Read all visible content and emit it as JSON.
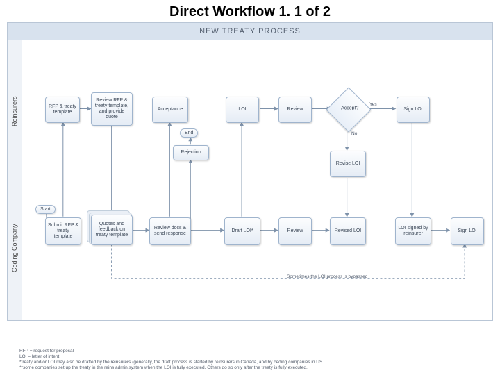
{
  "title": "Direct Workflow 1. 1 of 2",
  "header": "NEW TREATY PROCESS",
  "lanes": {
    "top": "Reinsurers",
    "bottom": "Ceding Company"
  },
  "reinsurers": {
    "rfp": "RFP & treaty template",
    "review_rfp": "Review RFP & treaty template, and provide quote",
    "acceptance": "Acceptance",
    "loi": "LOI",
    "review": "Review",
    "accept_q": "Accept?",
    "sign_loi": "Sign LOI",
    "rejection": "Rejection",
    "end": "End",
    "revise_loi": "Revise LOI"
  },
  "ceding": {
    "start": "Start",
    "submit": "Submit RFP & treaty template",
    "quotes": "Quotes and feedback on treaty template",
    "review_docs": "Review docs & send response",
    "draft_loi": "Draft LOI*",
    "review": "Review",
    "revised": "Revised LOI",
    "signed_by_reins": "LOI signed by reinsurer",
    "sign_loi": "Sign LOI"
  },
  "edge_labels": {
    "yes": "Yes",
    "no": "No"
  },
  "note_bypass": "Sometimes the LOI process is bypassed",
  "footnotes": {
    "l1": "RFP = request for proposal",
    "l2": "LOI = letter of intent",
    "l3": "*treaty and/or LOI may also be drafted by the reinsurers (generally, the draft process is started by reinsurers in Canada, and by ceding companies in US.",
    "l4": "**some companies set up the treaty in the reins admin system when the LOI is fully executed.  Others do so only after the treaty is fully executed."
  },
  "chart_data": {
    "type": "swimlane-flowchart",
    "title": "NEW TREATY PROCESS",
    "lanes": [
      "Reinsurers",
      "Ceding Company"
    ],
    "nodes": [
      {
        "id": "start",
        "lane": "Ceding Company",
        "type": "terminator",
        "label": "Start"
      },
      {
        "id": "submit",
        "lane": "Ceding Company",
        "type": "process",
        "label": "Submit RFP & treaty template"
      },
      {
        "id": "rfp",
        "lane": "Reinsurers",
        "type": "process",
        "label": "RFP & treaty template"
      },
      {
        "id": "review_rfp",
        "lane": "Reinsurers",
        "type": "process",
        "label": "Review RFP & treaty template, and provide quote"
      },
      {
        "id": "quotes",
        "lane": "Ceding Company",
        "type": "process-stack",
        "label": "Quotes and feedback on treaty template"
      },
      {
        "id": "review_docs",
        "lane": "Ceding Company",
        "type": "process",
        "label": "Review docs & send response"
      },
      {
        "id": "acceptance",
        "lane": "Reinsurers",
        "type": "process",
        "label": "Acceptance"
      },
      {
        "id": "rejection",
        "lane": "Reinsurers",
        "type": "process",
        "label": "Rejection"
      },
      {
        "id": "end",
        "lane": "Reinsurers",
        "type": "terminator",
        "label": "End"
      },
      {
        "id": "draft_loi",
        "lane": "Ceding Company",
        "type": "process",
        "label": "Draft LOI*"
      },
      {
        "id": "loi",
        "lane": "Reinsurers",
        "type": "process",
        "label": "LOI"
      },
      {
        "id": "review_r",
        "lane": "Reinsurers",
        "type": "process",
        "label": "Review"
      },
      {
        "id": "accept_q",
        "lane": "Reinsurers",
        "type": "decision",
        "label": "Accept?"
      },
      {
        "id": "sign_loi_r",
        "lane": "Reinsurers",
        "type": "process",
        "label": "Sign LOI"
      },
      {
        "id": "revise_loi",
        "lane": "Reinsurers",
        "type": "process",
        "label": "Revise LOI"
      },
      {
        "id": "review_c",
        "lane": "Ceding Company",
        "type": "process",
        "label": "Review"
      },
      {
        "id": "revised",
        "lane": "Ceding Company",
        "type": "process",
        "label": "Revised LOI"
      },
      {
        "id": "signed_by_reins",
        "lane": "Ceding Company",
        "type": "process",
        "label": "LOI signed by reinsurer"
      },
      {
        "id": "sign_loi_c",
        "lane": "Ceding Company",
        "type": "process",
        "label": "Sign LOI"
      }
    ],
    "edges": [
      {
        "from": "start",
        "to": "submit"
      },
      {
        "from": "submit",
        "to": "rfp"
      },
      {
        "from": "rfp",
        "to": "review_rfp"
      },
      {
        "from": "review_rfp",
        "to": "quotes"
      },
      {
        "from": "quotes",
        "to": "review_docs"
      },
      {
        "from": "review_docs",
        "to": "acceptance"
      },
      {
        "from": "review_docs",
        "to": "rejection"
      },
      {
        "from": "rejection",
        "to": "end"
      },
      {
        "from": "review_docs",
        "to": "draft_loi"
      },
      {
        "from": "draft_loi",
        "to": "loi"
      },
      {
        "from": "loi",
        "to": "review_r"
      },
      {
        "from": "review_r",
        "to": "accept_q"
      },
      {
        "from": "accept_q",
        "to": "sign_loi_r",
        "label": "Yes"
      },
      {
        "from": "accept_q",
        "to": "revise_loi",
        "label": "No"
      },
      {
        "from": "draft_loi",
        "to": "review_c"
      },
      {
        "from": "review_c",
        "to": "revised"
      },
      {
        "from": "revise_loi",
        "to": "revised"
      },
      {
        "from": "sign_loi_r",
        "to": "signed_by_reins"
      },
      {
        "from": "signed_by_reins",
        "to": "sign_loi_c"
      },
      {
        "from": "quotes",
        "to": "sign_loi_c",
        "style": "dashed",
        "note": "Sometimes the LOI process is bypassed"
      }
    ]
  }
}
